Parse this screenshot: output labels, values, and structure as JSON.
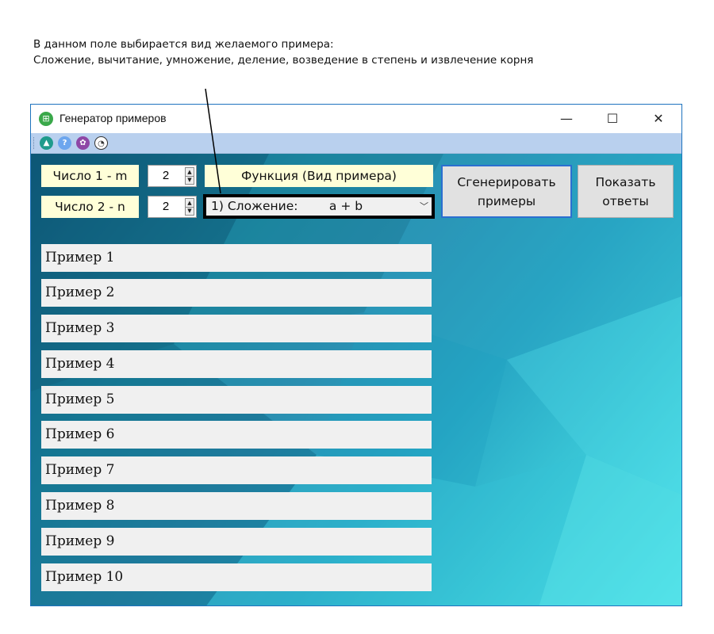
{
  "annotation": {
    "line1": "В данном поле выбирается вид желаемого примера:",
    "line2": "Сложение, вычитание, умножение, деление, возведение в степень и извлечение корня"
  },
  "window": {
    "title": "Генератор примеров",
    "controls": {
      "minimize": "—",
      "maximize": "☐",
      "close": "✕"
    }
  },
  "toolbar": {
    "icons": [
      "up-triangle-icon",
      "help-icon",
      "settings-icon",
      "speedometer-icon"
    ],
    "help_glyph": "?"
  },
  "inputs": {
    "number1_label": "Число 1 - m",
    "number1_value": "2",
    "number2_label": "Число 2 - n",
    "number2_value": "2",
    "function_label": "Функция (Вид примера)",
    "function_selected": "1) Сложение:        a + b"
  },
  "buttons": {
    "generate": "Сгенерировать примеры",
    "show_answers": "Показать ответы"
  },
  "examples": [
    "Пример 1",
    "Пример 2",
    "Пример 3",
    "Пример 4",
    "Пример 5",
    "Пример 6",
    "Пример 7",
    "Пример 8",
    "Пример 9",
    "Пример 10"
  ],
  "colors": {
    "accent": "#2b6fd0",
    "toolbar": "#b9d0ee",
    "label_bg": "#ffffd8"
  }
}
